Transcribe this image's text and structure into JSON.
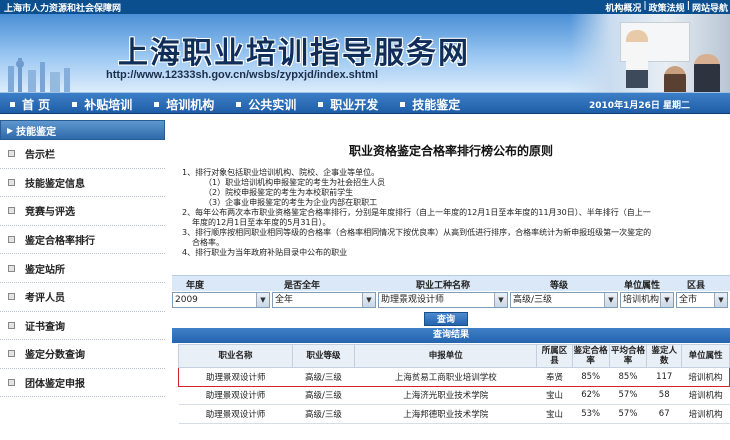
{
  "topbar": {
    "org": "上海市人力资源和社会保障网",
    "links": [
      "机构概况",
      "|",
      "政策法规",
      "|",
      "网站导航"
    ]
  },
  "banner": {
    "title": "上海职业培训指导服务网",
    "url": "http://www.12333sh.gov.cn/wsbs/zypxjd/index.shtml"
  },
  "nav": {
    "items": [
      "首 页",
      "补贴培训",
      "培训机构",
      "公共实训",
      "职业开发",
      "技能鉴定"
    ],
    "date": "2010年1月26日 星期二"
  },
  "sidebar": {
    "heading": "技能鉴定",
    "items": [
      "告示栏",
      "技能鉴定信息",
      "竞赛与评选",
      "鉴定合格率排行",
      "鉴定站所",
      "考评人员",
      "证书查询",
      "鉴定分数查询",
      "团体鉴定申报"
    ]
  },
  "main": {
    "title": "职业资格鉴定合格率排行榜公布的原则",
    "principles": [
      {
        "cls": "",
        "text": "1、排行对象包括职业培训机构、院校、企事业等单位。"
      },
      {
        "cls": "sub",
        "text": "（1）职业培训机构申报鉴定的考生为社会招生人员"
      },
      {
        "cls": "sub",
        "text": "（2）院校申报鉴定的考生为本校职前学生"
      },
      {
        "cls": "sub",
        "text": "（3）企事业申报鉴定的考生为企业内部在职职工"
      },
      {
        "cls": "",
        "text": "2、每年公布两次本市职业资格鉴定合格率排行，分别是年度排行（自上一年度的12月1日至本年度的11月30日）、半年排行（自上一"
      },
      {
        "cls": "cont",
        "text": "年度的12月1日至本年度的5月31日）。"
      },
      {
        "cls": "",
        "text": "3、排行顺序按相同职业相同等级的合格率（合格率相同情况下按优良率）从高到低进行排序，合格率统计为新申报班级第一次鉴定的"
      },
      {
        "cls": "cont",
        "text": "合格率。"
      },
      {
        "cls": "",
        "text": "4、排行职业为当年政府补贴目录中公布的职业"
      }
    ]
  },
  "query": {
    "headers": [
      "年度",
      "是否全年",
      "职业工种名称",
      "等级",
      "单位属性",
      "区县"
    ],
    "year": "2009",
    "full_year": "全年",
    "occupation": "助理景观设计师",
    "level": "高级/三级",
    "unit_type": "培训机构",
    "district": "全市",
    "button": "查询",
    "result_title": "查询结果"
  },
  "table": {
    "columns": [
      "职业名称",
      "职业等级",
      "申报单位",
      "所属区县",
      "鉴定合格率",
      "平均合格率",
      "鉴定人数",
      "单位属性"
    ],
    "rows": [
      [
        "助理景观设计师",
        "高级/三级",
        "上海贫易工商职业培训学校",
        "奉贤",
        "85%",
        "85%",
        "117",
        "培训机构"
      ],
      [
        "助理景观设计师",
        "高级/三级",
        "上海济光职业技术学院",
        "宝山",
        "62%",
        "57%",
        "58",
        "培训机构"
      ],
      [
        "助理景观设计师",
        "高级/三级",
        "上海邦德职业技术学院",
        "宝山",
        "53%",
        "57%",
        "67",
        "培训机构"
      ]
    ]
  }
}
